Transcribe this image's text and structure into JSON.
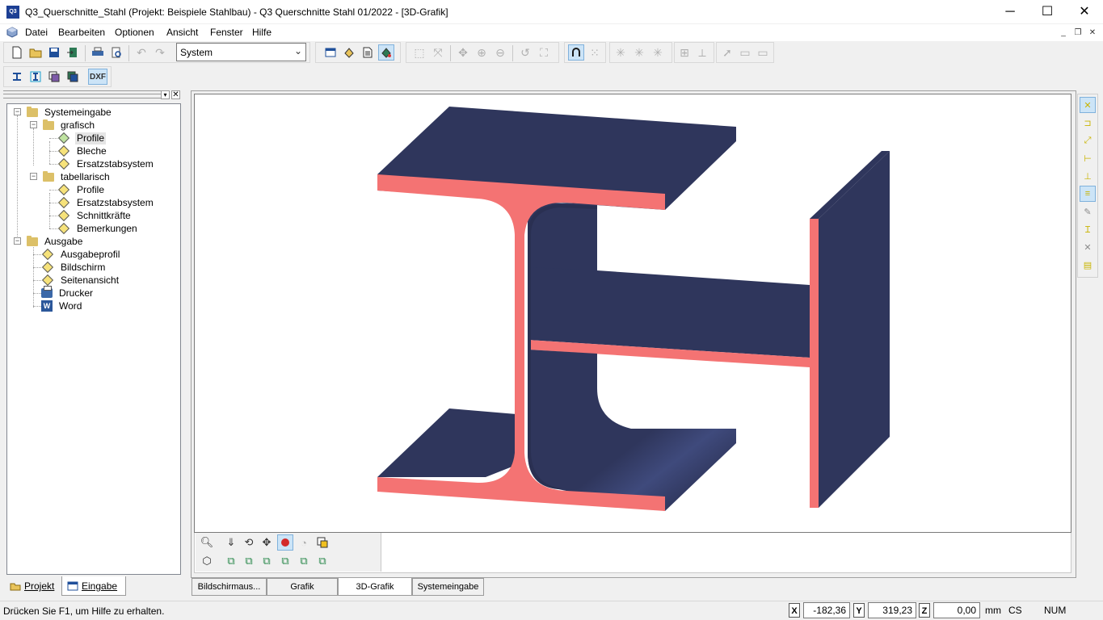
{
  "window": {
    "app_icon_text": "Q3",
    "title": "Q3_Querschnitte_Stahl (Projekt: Beispiele Stahlbau) - Q3 Querschnitte Stahl 01/2022 - [3D-Grafik]",
    "minimize_glyph": "─",
    "maximize_glyph": "☐",
    "close_glyph": "✕"
  },
  "menu": {
    "items": [
      "Datei",
      "Bearbeiten",
      "Optionen",
      "Ansicht",
      "Fenster",
      "Hilfe"
    ],
    "mdi_minimize": "_",
    "mdi_restore": "❐",
    "mdi_close": "✕"
  },
  "toolbar": {
    "system_select_value": "System",
    "dxf_label": "DXF"
  },
  "tree": {
    "pin_glyph": "▾",
    "close_glyph": "✕",
    "items": [
      {
        "label": "Systemeingabe",
        "icon": "folder-icon",
        "expander": "−"
      },
      {
        "label": "grafisch",
        "icon": "folder-icon",
        "expander": "−"
      },
      {
        "label": "Profile",
        "icon": "diamond-check-icon",
        "selected": true
      },
      {
        "label": "Bleche",
        "icon": "diamond-icon"
      },
      {
        "label": "Ersatzstabsystem",
        "icon": "diamond-icon"
      },
      {
        "label": "tabellarisch",
        "icon": "folder-icon",
        "expander": "−"
      },
      {
        "label": "Profile",
        "icon": "diamond-icon"
      },
      {
        "label": "Ersatzstabsystem",
        "icon": "diamond-icon"
      },
      {
        "label": "Schnittkräfte",
        "icon": "diamond-icon"
      },
      {
        "label": "Bemerkungen",
        "icon": "diamond-icon"
      },
      {
        "label": "Ausgabe",
        "icon": "folder-icon",
        "expander": "−"
      },
      {
        "label": "Ausgabeprofil",
        "icon": "diamond-icon"
      },
      {
        "label": "Bildschirm",
        "icon": "diamond-icon"
      },
      {
        "label": "Seitenansicht",
        "icon": "diamond-icon"
      },
      {
        "label": "Drucker",
        "icon": "printer-icon"
      },
      {
        "label": "Word",
        "icon": "word-icon",
        "icon_text": "W"
      }
    ]
  },
  "left_tabs": [
    {
      "label": "Projekt",
      "active": false
    },
    {
      "label": "Eingabe",
      "active": true
    }
  ],
  "view_tabs": [
    {
      "label": "Bildschirmaus...",
      "active": false
    },
    {
      "label": "Grafik",
      "active": false
    },
    {
      "label": "3D-Grafik",
      "active": true
    },
    {
      "label": "Systemeingabe",
      "active": false
    }
  ],
  "colors": {
    "section_face": "#f47373",
    "section_surface": "#2f365c",
    "section_surface_light": "#3a4473"
  },
  "status": {
    "help_text": "Drücken Sie F1, um Hilfe zu erhalten.",
    "x_label": "X",
    "y_label": "Y",
    "z_label": "Z",
    "x_value": "-182,36",
    "y_value": "319,23",
    "z_value": "0,00",
    "unit": "mm",
    "cs": "CS",
    "num": "NUM"
  }
}
